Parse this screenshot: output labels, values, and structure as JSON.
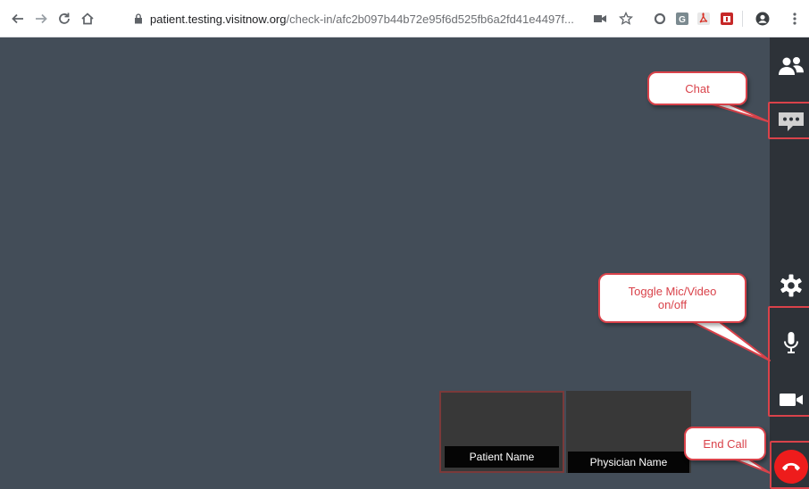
{
  "browser": {
    "url_host": "patient.testing.visitnow.org",
    "url_path": "/check-in/afc2b097b44b72e95f6d525fb6a2fd41e4497f...",
    "icons": [
      "back-arrow-icon",
      "forward-arrow-icon",
      "reload-icon",
      "home-icon",
      "lock-icon",
      "camera-icon",
      "star-icon",
      "extension-icons",
      "profile-icon",
      "menu-icon"
    ]
  },
  "video": {
    "tiles": [
      {
        "label": "Patient Name"
      },
      {
        "label": "Physician Name"
      }
    ]
  },
  "rail": {
    "buttons": [
      "participants-icon",
      "chat-icon",
      "settings-icon",
      "microphone-icon",
      "video-camera-icon",
      "end-call-icon"
    ]
  },
  "callouts": {
    "chat": "Chat",
    "toggle_line1": "Toggle Mic/Video",
    "toggle_line2": "on/off",
    "end_call": "End Call"
  },
  "colors": {
    "stage": "#434d58",
    "rail": "#2d3238",
    "annotation": "#d9424a",
    "end_call": "#ee1c1c"
  }
}
